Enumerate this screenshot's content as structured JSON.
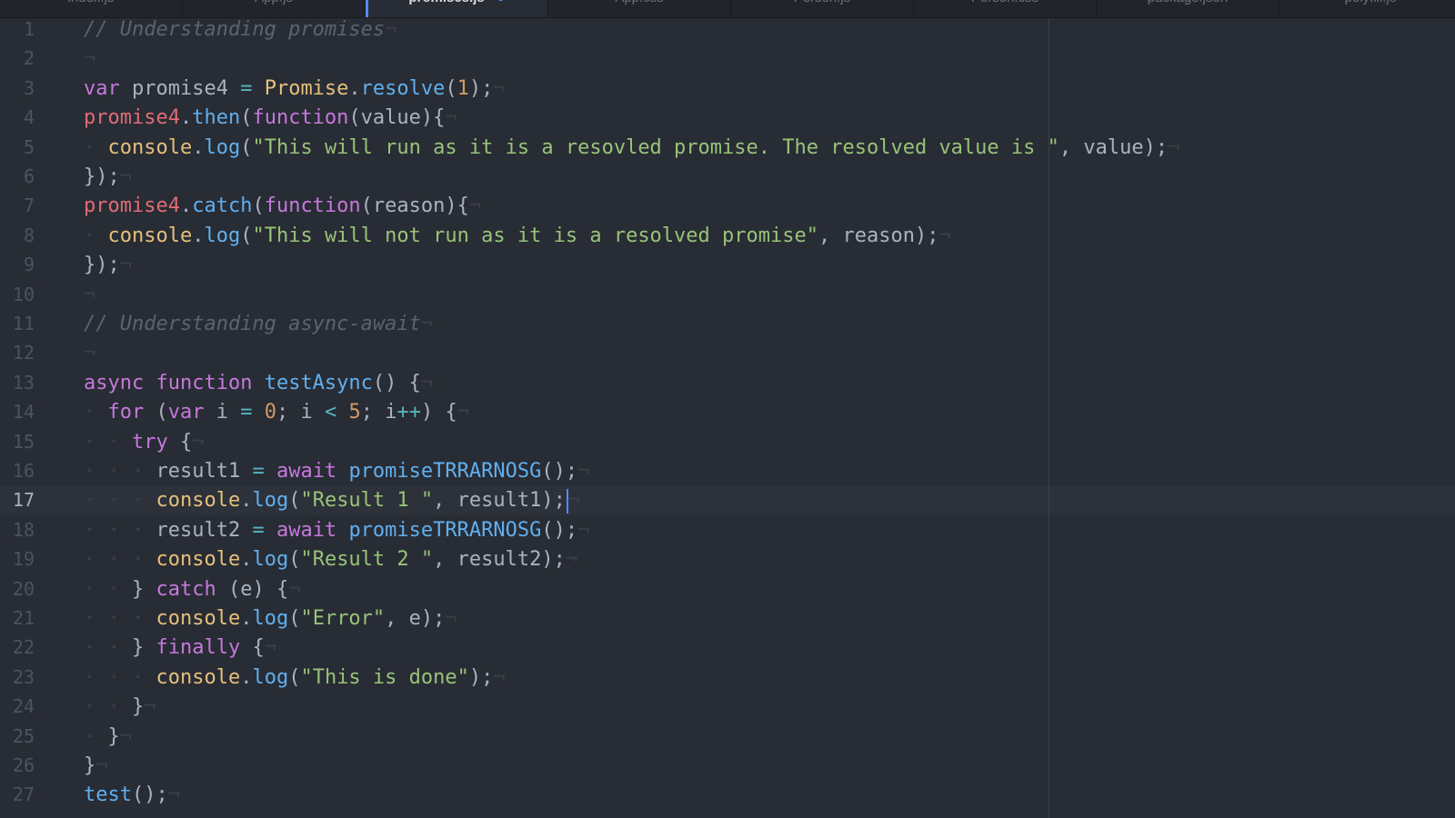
{
  "tabs": [
    {
      "label": "index.js",
      "active": false
    },
    {
      "label": "App.js",
      "active": false
    },
    {
      "label": "promises.js",
      "active": true,
      "modified": "●"
    },
    {
      "label": "App.css",
      "active": false
    },
    {
      "label": "Person.js",
      "active": false
    },
    {
      "label": "Person.css",
      "active": false
    },
    {
      "label": "package.json",
      "active": false
    },
    {
      "label": "polyfill.js",
      "active": false
    }
  ],
  "editor": {
    "cursor_line": 17,
    "eol_marker": "¬",
    "lines": [
      {
        "n": "1",
        "tokens": [
          [
            "c",
            "// Understanding promises"
          ]
        ]
      },
      {
        "n": "2",
        "tokens": []
      },
      {
        "n": "3",
        "tokens": [
          [
            "k",
            "var"
          ],
          [
            "p",
            " promise4 "
          ],
          [
            "o",
            "="
          ],
          [
            "p",
            " "
          ],
          [
            "cls",
            "Promise"
          ],
          [
            "p",
            "."
          ],
          [
            "f",
            "resolve"
          ],
          [
            "p",
            "("
          ],
          [
            "n",
            "1"
          ],
          [
            "p",
            ");"
          ]
        ]
      },
      {
        "n": "4",
        "tokens": [
          [
            "v",
            "promise4"
          ],
          [
            "p",
            "."
          ],
          [
            "f",
            "then"
          ],
          [
            "p",
            "("
          ],
          [
            "k",
            "function"
          ],
          [
            "p",
            "(value){"
          ]
        ]
      },
      {
        "n": "5",
        "tokens": [
          [
            "g",
            "· "
          ],
          [
            "cls",
            "console"
          ],
          [
            "p",
            "."
          ],
          [
            "f",
            "log"
          ],
          [
            "p",
            "("
          ],
          [
            "s",
            "\"This will run as it is a resovled promise. The resolved value is \""
          ],
          [
            "p",
            ", value);"
          ]
        ]
      },
      {
        "n": "6",
        "tokens": [
          [
            "p",
            "});"
          ]
        ]
      },
      {
        "n": "7",
        "tokens": [
          [
            "v",
            "promise4"
          ],
          [
            "p",
            "."
          ],
          [
            "f",
            "catch"
          ],
          [
            "p",
            "("
          ],
          [
            "k",
            "function"
          ],
          [
            "p",
            "(reason){"
          ]
        ]
      },
      {
        "n": "8",
        "tokens": [
          [
            "g",
            "· "
          ],
          [
            "cls",
            "console"
          ],
          [
            "p",
            "."
          ],
          [
            "f",
            "log"
          ],
          [
            "p",
            "("
          ],
          [
            "s",
            "\"This will not run as it is a resolved promise\""
          ],
          [
            "p",
            ", reason);"
          ]
        ]
      },
      {
        "n": "9",
        "tokens": [
          [
            "p",
            "});"
          ]
        ]
      },
      {
        "n": "10",
        "tokens": []
      },
      {
        "n": "11",
        "tokens": [
          [
            "c",
            "// Understanding async-await"
          ]
        ]
      },
      {
        "n": "12",
        "tokens": []
      },
      {
        "n": "13",
        "tokens": [
          [
            "k",
            "async"
          ],
          [
            "p",
            " "
          ],
          [
            "k",
            "function"
          ],
          [
            "p",
            " "
          ],
          [
            "f",
            "testAsync"
          ],
          [
            "p",
            "() {"
          ]
        ]
      },
      {
        "n": "14",
        "tokens": [
          [
            "g",
            "· "
          ],
          [
            "k",
            "for"
          ],
          [
            "p",
            " ("
          ],
          [
            "k",
            "var"
          ],
          [
            "p",
            " i "
          ],
          [
            "o",
            "="
          ],
          [
            "p",
            " "
          ],
          [
            "n",
            "0"
          ],
          [
            "p",
            "; i "
          ],
          [
            "o",
            "<"
          ],
          [
            "p",
            " "
          ],
          [
            "n",
            "5"
          ],
          [
            "p",
            "; i"
          ],
          [
            "o",
            "++"
          ],
          [
            "p",
            ") {"
          ]
        ]
      },
      {
        "n": "15",
        "tokens": [
          [
            "g",
            "· · "
          ],
          [
            "k",
            "try"
          ],
          [
            "p",
            " {"
          ]
        ]
      },
      {
        "n": "16",
        "tokens": [
          [
            "g",
            "· · · "
          ],
          [
            "p",
            "result1 "
          ],
          [
            "o",
            "="
          ],
          [
            "p",
            " "
          ],
          [
            "k",
            "await"
          ],
          [
            "p",
            " "
          ],
          [
            "f",
            "promiseTRRARNOSG"
          ],
          [
            "p",
            "();"
          ]
        ]
      },
      {
        "n": "17",
        "tokens": [
          [
            "g",
            "· · · "
          ],
          [
            "cls",
            "console"
          ],
          [
            "p",
            "."
          ],
          [
            "f",
            "log"
          ],
          [
            "p",
            "("
          ],
          [
            "s",
            "\"Result 1 \""
          ],
          [
            "p",
            ", result1);"
          ]
        ]
      },
      {
        "n": "18",
        "tokens": [
          [
            "g",
            "· · · "
          ],
          [
            "p",
            "result2 "
          ],
          [
            "o",
            "="
          ],
          [
            "p",
            " "
          ],
          [
            "k",
            "await"
          ],
          [
            "p",
            " "
          ],
          [
            "f",
            "promiseTRRARNOSG"
          ],
          [
            "p",
            "();"
          ]
        ]
      },
      {
        "n": "19",
        "tokens": [
          [
            "g",
            "· · · "
          ],
          [
            "cls",
            "console"
          ],
          [
            "p",
            "."
          ],
          [
            "f",
            "log"
          ],
          [
            "p",
            "("
          ],
          [
            "s",
            "\"Result 2 \""
          ],
          [
            "p",
            ", result2);"
          ]
        ]
      },
      {
        "n": "20",
        "tokens": [
          [
            "g",
            "· · "
          ],
          [
            "p",
            "} "
          ],
          [
            "k",
            "catch"
          ],
          [
            "p",
            " (e) {"
          ]
        ]
      },
      {
        "n": "21",
        "tokens": [
          [
            "g",
            "· · · "
          ],
          [
            "cls",
            "console"
          ],
          [
            "p",
            "."
          ],
          [
            "f",
            "log"
          ],
          [
            "p",
            "("
          ],
          [
            "s",
            "\"Error\""
          ],
          [
            "p",
            ", e);"
          ]
        ]
      },
      {
        "n": "22",
        "tokens": [
          [
            "g",
            "· · "
          ],
          [
            "p",
            "} "
          ],
          [
            "k",
            "finally"
          ],
          [
            "p",
            " {"
          ]
        ]
      },
      {
        "n": "23",
        "tokens": [
          [
            "g",
            "· · · "
          ],
          [
            "cls",
            "console"
          ],
          [
            "p",
            "."
          ],
          [
            "f",
            "log"
          ],
          [
            "p",
            "("
          ],
          [
            "s",
            "\"This is done\""
          ],
          [
            "p",
            ");"
          ]
        ]
      },
      {
        "n": "24",
        "tokens": [
          [
            "g",
            "· · "
          ],
          [
            "p",
            "}"
          ]
        ]
      },
      {
        "n": "25",
        "tokens": [
          [
            "g",
            "· "
          ],
          [
            "p",
            "}"
          ]
        ]
      },
      {
        "n": "26",
        "tokens": [
          [
            "p",
            "}"
          ]
        ]
      },
      {
        "n": "27",
        "tokens": [
          [
            "f",
            "test"
          ],
          [
            "p",
            "();"
          ]
        ]
      }
    ]
  }
}
